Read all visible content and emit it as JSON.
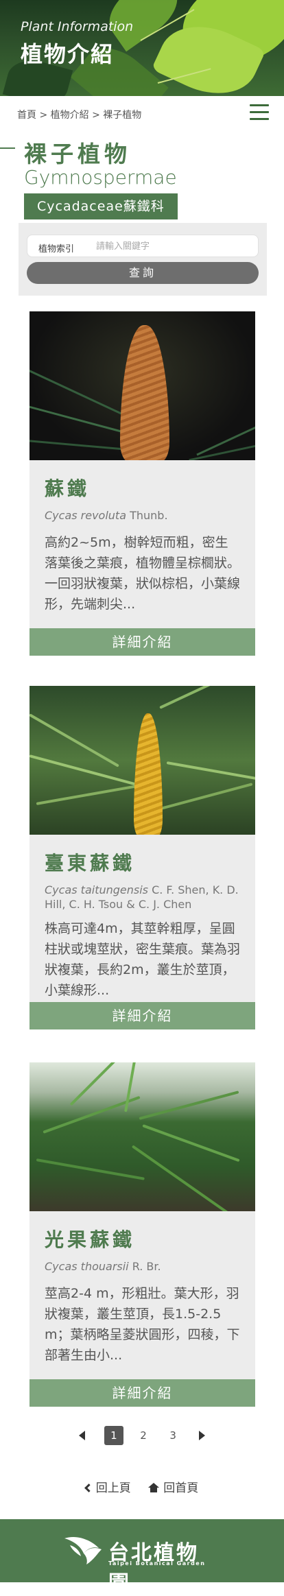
{
  "banner": {
    "subtitle": "Plant Information",
    "title": "植物介紹"
  },
  "breadcrumb": {
    "items": [
      "首頁",
      "植物介紹",
      "裸子植物"
    ],
    "separator": ">"
  },
  "category": {
    "name_zh": "裸子植物",
    "name_en": "Gymnospermae",
    "family": "Cycadaceae蘇鐵科"
  },
  "search": {
    "label": "植物索引",
    "placeholder": "請輸入關鍵字",
    "value": "",
    "button": "查詢"
  },
  "plants": [
    {
      "name": "蘇鐵",
      "sci_genus": "Cycas revoluta",
      "sci_author": " Thunb.",
      "description": "高約2~5m，樹幹短而粗，密生落葉後之葉痕，植物體呈棕櫚狀。一回羽狀複葉，狀似棕梠，小葉線形，先端刺尖...",
      "more": "詳細介紹"
    },
    {
      "name": "臺東蘇鐵",
      "sci_genus": "Cycas taitungensis",
      "sci_author": " C. F. Shen, K. D. Hill, C. H. Tsou & C. J. Chen",
      "description": "株高可達4m，其莖幹粗厚，呈圓柱狀或塊莖狀，密生葉痕。葉為羽狀複葉，長約2m，叢生於莖頂，小葉線形...",
      "more": "詳細介紹"
    },
    {
      "name": "光果蘇鐵",
      "sci_genus": "Cycas thouarsii",
      "sci_author": " R. Br.",
      "description": "莖高2-4 m，形粗壯。葉大形，羽狀複葉，叢生莖頂，長1.5-2.5 m；葉柄略呈菱狀圓形，四稜，下部著生由小...",
      "more": "詳細介紹"
    }
  ],
  "pagination": {
    "pages": [
      "1",
      "2",
      "3"
    ],
    "current": "1"
  },
  "nav": {
    "back": "回上頁",
    "home": "回首頁"
  },
  "footer": {
    "logo_zh": "台北植物園",
    "logo_en": "Taipei Botanical Garden"
  },
  "colors": {
    "primary_green": "#4f7b4f",
    "button_green": "#7ea57d",
    "search_button": "#6e6e6e",
    "card_bg": "#ececec"
  }
}
